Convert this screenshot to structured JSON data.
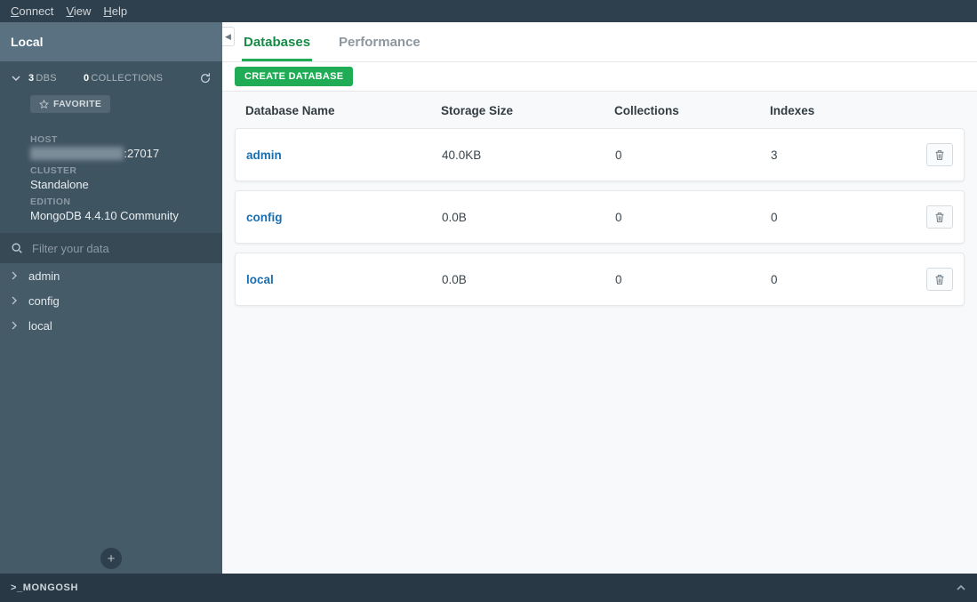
{
  "menu": {
    "connect": "Connect",
    "view": "View",
    "help": "Help"
  },
  "sidebar": {
    "connection_name": "Local",
    "dbs_count": "3",
    "dbs_label": "DBS",
    "cols_count": "0",
    "cols_label": "COLLECTIONS",
    "favorite_label": "FAVORITE",
    "host_label": "HOST",
    "host_value_masked": "███████████",
    "host_port": ":27017",
    "cluster_label": "CLUSTER",
    "cluster_value": "Standalone",
    "edition_label": "EDITION",
    "edition_value": "MongoDB 4.4.10 Community",
    "filter_placeholder": "Filter your data",
    "items": [
      {
        "name": "admin"
      },
      {
        "name": "config"
      },
      {
        "name": "local"
      }
    ]
  },
  "tabs": {
    "databases": "Databases",
    "performance": "Performance"
  },
  "toolbar": {
    "create_label": "CREATE DATABASE"
  },
  "table": {
    "headers": {
      "name": "Database Name",
      "storage": "Storage Size",
      "collections": "Collections",
      "indexes": "Indexes"
    },
    "rows": [
      {
        "name": "admin",
        "storage": "40.0KB",
        "collections": "0",
        "indexes": "3"
      },
      {
        "name": "config",
        "storage": "0.0B",
        "collections": "0",
        "indexes": "0"
      },
      {
        "name": "local",
        "storage": "0.0B",
        "collections": "0",
        "indexes": "0"
      }
    ]
  },
  "footer": {
    "shell_label": ">_MONGOSH"
  }
}
